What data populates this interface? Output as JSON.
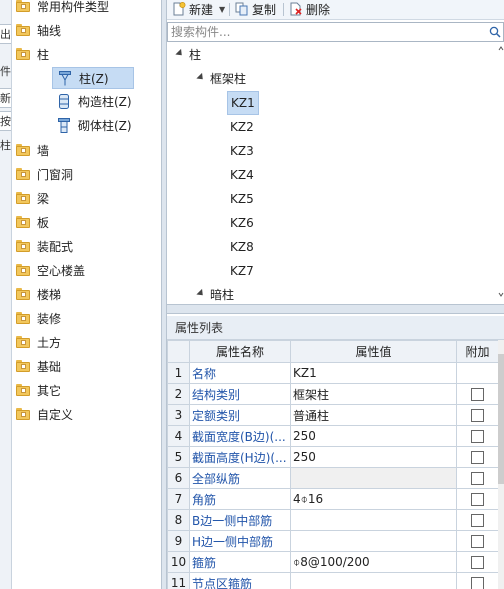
{
  "left_strip": {
    "fragments": [
      {
        "text": "出F"
      },
      {
        "text": "件"
      },
      {
        "text": "新"
      },
      {
        "text": "按"
      },
      {
        "text": "柱"
      }
    ]
  },
  "categories": [
    {
      "label": "常用构件类型"
    },
    {
      "label": "轴线"
    },
    {
      "label": "柱"
    },
    {
      "label": "墙"
    },
    {
      "label": "门窗洞"
    },
    {
      "label": "梁"
    },
    {
      "label": "板"
    },
    {
      "label": "装配式"
    },
    {
      "label": "空心楼盖"
    },
    {
      "label": "楼梯"
    },
    {
      "label": "装修"
    },
    {
      "label": "土方"
    },
    {
      "label": "基础"
    },
    {
      "label": "其它"
    },
    {
      "label": "自定义"
    }
  ],
  "column_subitems": [
    {
      "label": "柱(Z)",
      "icon": "column-icon",
      "selected": true
    },
    {
      "label": "构造柱(Z)",
      "icon": "constructional-column-icon",
      "selected": false
    },
    {
      "label": "砌体柱(Z)",
      "icon": "masonry-column-icon",
      "selected": false
    }
  ],
  "toolbar": {
    "new_label": "新建",
    "copy_label": "复制",
    "delete_label": "删除"
  },
  "search": {
    "placeholder": "搜索构件..."
  },
  "component_tree": {
    "root": "柱",
    "group1": "框架柱",
    "items": [
      "KZ1",
      "KZ2",
      "KZ3",
      "KZ4",
      "KZ5",
      "KZ6",
      "KZ8",
      "KZ7"
    ],
    "selected": "KZ1",
    "group2": "暗柱"
  },
  "properties": {
    "title": "属性列表",
    "headers": {
      "name": "属性名称",
      "value": "属性值",
      "add": "附加"
    },
    "rows": [
      {
        "n": "1",
        "name": "名称",
        "value": "KZ1",
        "has_check": false,
        "gray": false
      },
      {
        "n": "2",
        "name": "结构类别",
        "value": "框架柱",
        "has_check": true,
        "gray": false
      },
      {
        "n": "3",
        "name": "定额类别",
        "value": "普通柱",
        "has_check": true,
        "gray": false
      },
      {
        "n": "4",
        "name": "截面宽度(B边)(...",
        "value": "250",
        "has_check": true,
        "gray": false
      },
      {
        "n": "5",
        "name": "截面高度(H边)(...",
        "value": "250",
        "has_check": true,
        "gray": false
      },
      {
        "n": "6",
        "name": "全部纵筋",
        "value": "",
        "has_check": true,
        "gray": true
      },
      {
        "n": "7",
        "name": "角筋",
        "value": "4⌽16",
        "has_check": true,
        "gray": false
      },
      {
        "n": "8",
        "name": "B边一侧中部筋",
        "value": "",
        "has_check": true,
        "gray": false
      },
      {
        "n": "9",
        "name": "H边一侧中部筋",
        "value": "",
        "has_check": true,
        "gray": false
      },
      {
        "n": "10",
        "name": "箍筋",
        "value": "⌽8@100/200",
        "has_check": true,
        "gray": false
      },
      {
        "n": "11",
        "name": "节点区箍筋",
        "value": "",
        "has_check": true,
        "gray": false
      }
    ]
  }
}
